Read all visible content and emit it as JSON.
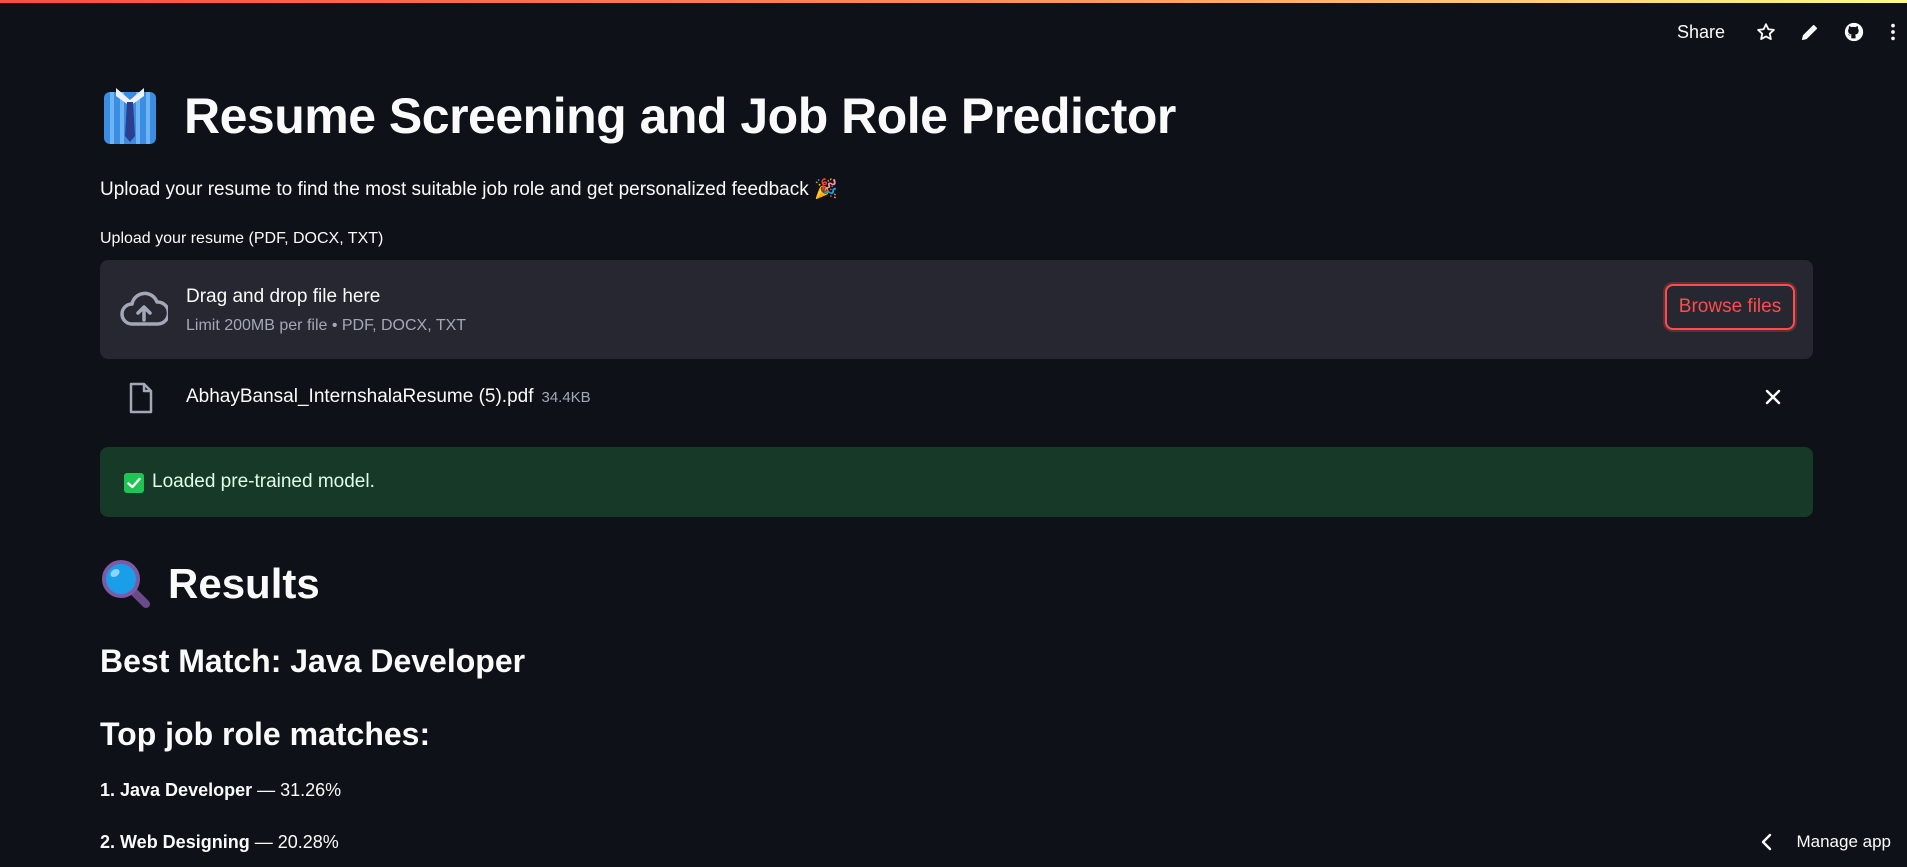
{
  "toolbar": {
    "share_label": "Share",
    "icons": [
      "star-icon",
      "pencil-icon",
      "github-icon",
      "kebab-menu-icon"
    ]
  },
  "header": {
    "title": "Resume Screening and Job Role Predictor",
    "title_icon": "necktie-shirt-emoji",
    "subtitle": "Upload your resume to find the most suitable job role and get personalized feedback 🎉"
  },
  "uploader": {
    "label": "Upload your resume (PDF, DOCX, TXT)",
    "drop_text": "Drag and drop file here",
    "limit_text": "Limit 200MB per file • PDF, DOCX, TXT",
    "browse_label": "Browse files"
  },
  "uploaded_file": {
    "name": "AbhayBansal_InternshalaResume (5).pdf",
    "size": "34.4KB"
  },
  "alert": {
    "text": "Loaded pre-trained model."
  },
  "results": {
    "heading": "Results",
    "heading_icon": "magnifying-glass-emoji",
    "best_match": "Best Match: Java Developer",
    "top_matches_heading": "Top job role matches:",
    "matches": [
      {
        "rank_role": "1. Java Developer",
        "score": " — 31.26%"
      },
      {
        "rank_role": "2. Web Designing",
        "score": " — 20.28%"
      }
    ]
  },
  "footer": {
    "manage_label": "Manage app"
  },
  "colors": {
    "background": "#0e1117",
    "surface": "#262730",
    "accent": "#ff4b4b",
    "success_bg": "#173928",
    "success_icon": "#21c354"
  }
}
